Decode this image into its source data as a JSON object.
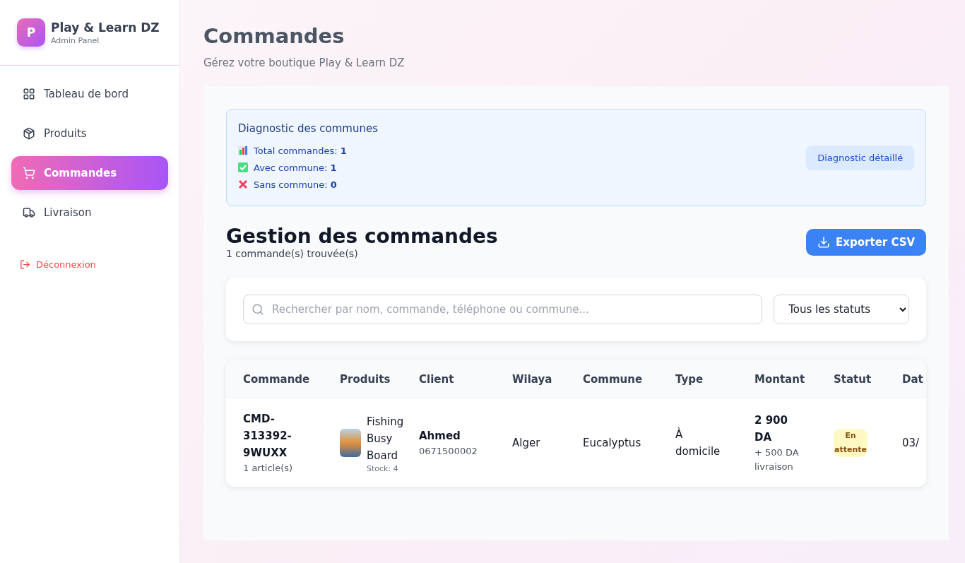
{
  "brand": {
    "logo_letter": "P",
    "name": "Play & Learn DZ",
    "subtitle": "Admin Panel"
  },
  "nav": [
    {
      "kind": "grid",
      "label": "Tableau de bord",
      "selected": false
    },
    {
      "kind": "box",
      "label": "Produits",
      "selected": false
    },
    {
      "kind": "cart",
      "label": "Commandes",
      "selected": true
    },
    {
      "kind": "truck",
      "label": "Livraison",
      "selected": false
    }
  ],
  "logout": "Déconnexion",
  "page": {
    "title": "Commandes",
    "subtitle": "Gérez votre boutique Play & Learn DZ"
  },
  "diagnostic": {
    "title": "Diagnostic des communes",
    "lines": [
      {
        "kind": "chart",
        "text": "Total commandes: **1**"
      },
      {
        "kind": "check",
        "text": "Avec commune: **1**"
      },
      {
        "kind": "cross",
        "text": "Sans commune: **0**"
      }
    ],
    "button": "Diagnostic détaillé"
  },
  "section": {
    "title": "Gestion des commandes",
    "count": "1 commande(s) trouvée(s)",
    "export": "Exporter CSV"
  },
  "filters": {
    "search_placeholder": "Rechercher par nom, commande, téléphone ou commune...",
    "status": "Tous les statuts"
  },
  "table": {
    "columns": [
      "Commande",
      "Produits",
      "Client",
      "Wilaya",
      "Commune",
      "Type",
      "Montant",
      "Statut",
      "Dat"
    ],
    "rows": [
      {
        "order": "CMD-313392-9WUXX",
        "items": "1 article(s)",
        "product": "Fishing Busy Board",
        "stock": "Stock: 4",
        "client": "Ahmed",
        "phone": "0671500002",
        "wilaya": "Alger",
        "commune": "Eucalyptus",
        "type": "À domicile",
        "amount": "2 900 DA",
        "delivery": "+ 500 DA livraison",
        "status": "En attente",
        "date": "03/"
      }
    ]
  }
}
